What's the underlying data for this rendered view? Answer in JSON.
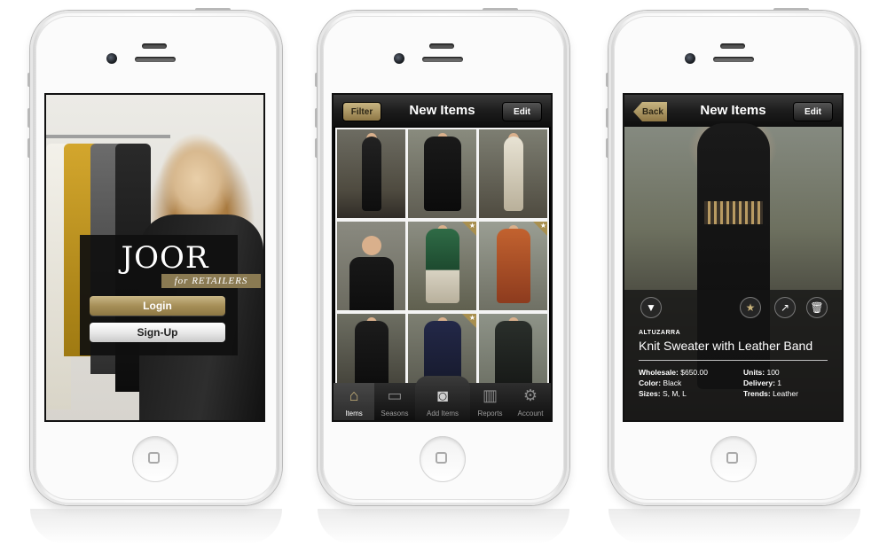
{
  "screen1": {
    "logo": "JOOR",
    "tagline": "for RETAILERS",
    "login_label": "Login",
    "signup_label": "Sign-Up"
  },
  "screen2": {
    "title": "New Items",
    "filter_label": "Filter",
    "edit_label": "Edit",
    "tabs": [
      {
        "label": "Items",
        "icon": "hanger-icon",
        "active": true
      },
      {
        "label": "Seasons",
        "icon": "folder-icon",
        "active": false
      },
      {
        "label": "Add Items",
        "icon": "camera-icon",
        "active": false
      },
      {
        "label": "Reports",
        "icon": "bar-chart-icon",
        "active": false
      },
      {
        "label": "Account",
        "icon": "gear-icon",
        "active": false
      }
    ],
    "grid_starred": [
      false,
      false,
      false,
      false,
      true,
      true,
      false,
      true,
      false
    ]
  },
  "screen3": {
    "title": "New Items",
    "back_label": "Back",
    "edit_label": "Edit",
    "brand": "ALTUZARRA",
    "product_name": "Knit Sweater with Leather Band",
    "wholesale_label": "Wholesale:",
    "wholesale_value": "$650.00",
    "color_label": "Color:",
    "color_value": "Black",
    "sizes_label": "Sizes:",
    "sizes_value": "S, M, L",
    "units_label": "Units:",
    "units_value": "100",
    "delivery_label": "Delivery:",
    "delivery_value": "1",
    "trends_label": "Trends:",
    "trends_value": "Leather"
  },
  "colors": {
    "gold_accent": "#a68f58",
    "navbar_dark": "#1c1c1c"
  }
}
